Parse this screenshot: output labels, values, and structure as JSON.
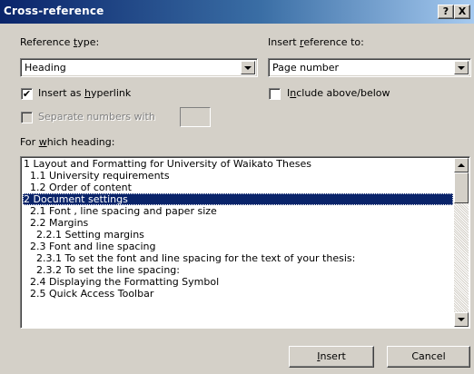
{
  "window": {
    "title": "Cross-reference",
    "help_label": "?",
    "close_label": "X"
  },
  "reference_type": {
    "label_pre": "Reference ",
    "label_key": "t",
    "label_post": "ype:",
    "value": "Heading"
  },
  "insert_reference_to": {
    "label_pre": "Insert ",
    "label_key": "r",
    "label_post": "eference to:",
    "value": "Page number"
  },
  "insert_as_hyperlink": {
    "label_pre": "Insert as ",
    "label_key": "h",
    "label_post": "yperlink",
    "checked": true,
    "check_glyph": "✔"
  },
  "include_above_below": {
    "label_pre": "I",
    "label_key": "n",
    "label_post": "clude above/below",
    "checked": false
  },
  "separate_numbers": {
    "label": "Separate numbers with",
    "enabled": false,
    "value": ""
  },
  "for_which_heading": {
    "label_pre": "For ",
    "label_key": "w",
    "label_post": "hich heading:"
  },
  "headings": [
    "1 Layout and Formatting for University of Waikato Theses",
    "1.1 University requirements",
    "1.2 Order of content",
    "2 Document settings",
    "2.1 Font , line spacing and paper size",
    "2.2 Margins",
    "2.2.1 Setting margins",
    "2.3 Font and line spacing",
    "2.3.1 To set the font and line spacing for the text of your thesis:",
    "2.3.2 To set the line spacing:",
    "2.4 Displaying the Formatting Symbol",
    "2.5 Quick Access Toolbar"
  ],
  "selected_heading_index": 3,
  "buttons": {
    "insert_key": "I",
    "insert_rest": "nsert",
    "cancel": "Cancel"
  },
  "colors": {
    "dialog_bg": "#d4d0c8",
    "title_gradient_start": "#0a246a",
    "title_gradient_end": "#a6caf0",
    "selection": "#0a246a"
  }
}
